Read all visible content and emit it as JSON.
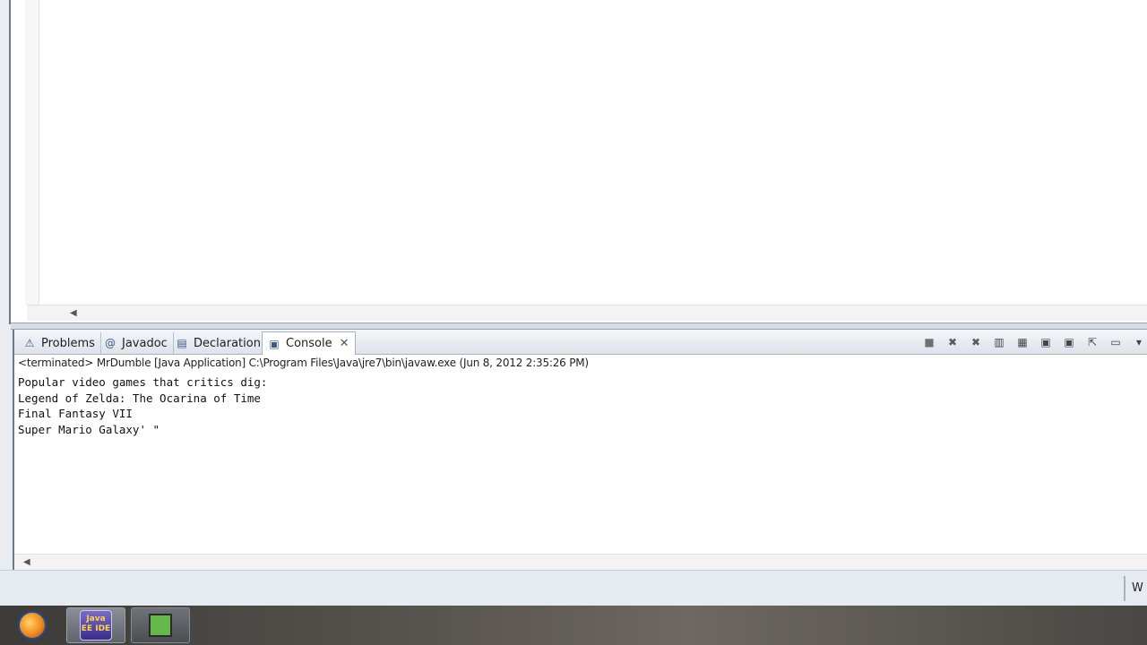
{
  "panel": {
    "tabs": [
      {
        "label": "Problems",
        "icon": "problems-icon",
        "active": false
      },
      {
        "label": "Javadoc",
        "icon": "javadoc-icon",
        "active": false
      },
      {
        "label": "Declaration",
        "icon": "declaration-icon",
        "active": false
      },
      {
        "label": "Console",
        "icon": "console-icon",
        "active": true
      }
    ],
    "toolbar_icons": [
      "terminate-icon",
      "remove-launch-icon",
      "remove-all-launches-icon",
      "scroll-lock-icon",
      "pin-console-icon",
      "show-on-stdout-icon",
      "show-on-stderr-icon",
      "open-console-icon",
      "display-console-icon",
      "view-menu-icon"
    ]
  },
  "console": {
    "status": "<terminated> MrDumble [Java Application] C:\\Program Files\\Java\\jre7\\bin\\javaw.exe (Jun 8, 2012 2:35:26 PM)",
    "lines": [
      "Popular video games that critics dig:",
      "Legend of Zelda: The Ocarina of Time",
      "Final Fantasy VII",
      "Super Mario Galaxy' \""
    ]
  },
  "statusbar": {
    "right_text": "W"
  },
  "taskbar": {
    "items": [
      "firefox-icon",
      "java-ee-ide-icon",
      "app-icon"
    ],
    "javaee_label": "Java EE IDE"
  },
  "colors": {
    "accent": "#3d5a80",
    "panel_bg": "#ffffff",
    "tabbar_bg": "#dde3ea"
  }
}
